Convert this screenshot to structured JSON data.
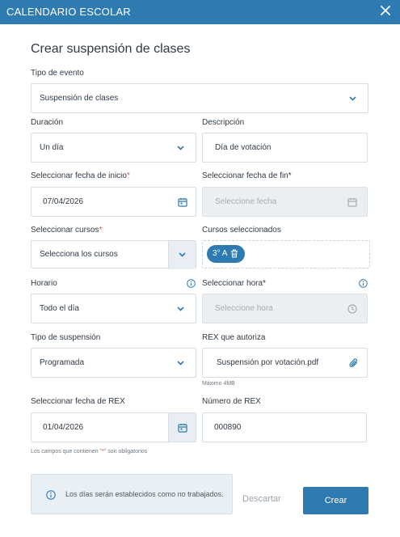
{
  "header": {
    "title": "CALENDARIO ESCOLAR",
    "close_icon": "close-icon"
  },
  "page_title": "Crear suspensión de clases",
  "tipo_evento": {
    "label": "Tipo de evento",
    "value": "Suspensión de clases"
  },
  "duracion": {
    "label": "Duración",
    "value": "Un día"
  },
  "descripcion": {
    "label": "Descripción",
    "value": "Día de votación"
  },
  "fecha_inicio": {
    "label": "Seleccionar fecha de inicio",
    "required": "*",
    "value": "07/04/2026"
  },
  "fecha_fin": {
    "label": "Seleccionar fecha de fin*",
    "placeholder": "Seleccione fecha"
  },
  "cursos": {
    "label": "Seleccionar cursos",
    "required": "*",
    "value": "Selecciona los cursos"
  },
  "cursos_seleccionados": {
    "label": "Cursos seleccionados",
    "chips": [
      "3° A"
    ]
  },
  "horario": {
    "label": "Horario",
    "value": "Todo el día"
  },
  "hora": {
    "label": "Seleccionar hora*",
    "placeholder": "Seleccione hora"
  },
  "tipo_suspension": {
    "label": "Tipo de suspensión",
    "value": "Programada"
  },
  "rex": {
    "label": "REX que autoriza",
    "file": "Suspensión por votación.pdf",
    "hint": "Máximo 4MB"
  },
  "fecha_rex": {
    "label": "Seleccionar fecha de REX",
    "value": "01/04/2026"
  },
  "numero_rex": {
    "label": "Número de REX",
    "value": "000890"
  },
  "required_note": {
    "prefix": "Los campos que contienen ",
    "mark": "\"*\"",
    "suffix": " son obligatorios"
  },
  "notice": {
    "text_prefix": "Los días serán establecidos como ",
    "text_bold": "no trabajados",
    "text_suffix": "."
  },
  "actions": {
    "discard": "Descartar",
    "create": "Crear"
  },
  "colors": {
    "primary": "#2e7bb2",
    "required": "#d9534f",
    "disabled_bg": "#eceff2",
    "notice_bg": "#e8f0f6"
  }
}
